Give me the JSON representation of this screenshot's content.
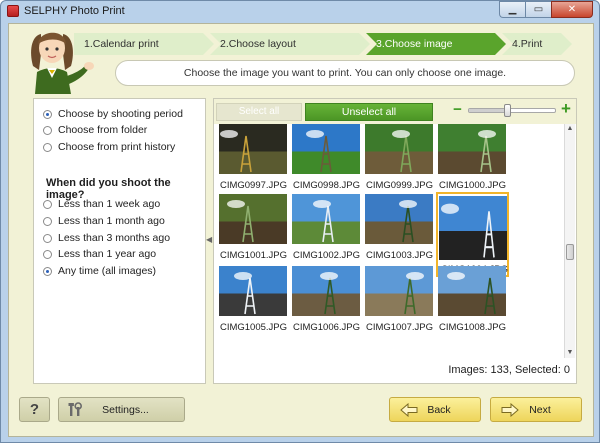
{
  "window": {
    "title": "SELPHY Photo Print",
    "minimize_icon": "minimize-icon",
    "maximize_icon": "maximize-icon",
    "close_icon": "close-icon"
  },
  "steps": [
    {
      "label": "1.Calendar print",
      "active": false
    },
    {
      "label": "2.Choose layout",
      "active": false
    },
    {
      "label": "3.Choose image",
      "active": true
    },
    {
      "label": "4.Print",
      "active": false
    }
  ],
  "instruction": "Choose the image you want to print. You can only choose one image.",
  "filter_mode": {
    "options": [
      {
        "label": "Choose by shooting period",
        "selected": true
      },
      {
        "label": "Choose from folder",
        "selected": false
      },
      {
        "label": "Choose from print history",
        "selected": false
      }
    ]
  },
  "period": {
    "heading": "When did you shoot the image?",
    "options": [
      {
        "label": "Less than 1 week ago",
        "selected": false
      },
      {
        "label": "Less than 1 month ago",
        "selected": false
      },
      {
        "label": "Less than 3 months ago",
        "selected": false
      },
      {
        "label": "Less than 1 year ago",
        "selected": false
      },
      {
        "label": "Any time (all images)",
        "selected": true
      }
    ]
  },
  "toolbar": {
    "select_all_label": "Select all",
    "unselect_all_label": "Unselect all",
    "zoom_minus": "−",
    "zoom_plus": "+",
    "zoom_level": 0.45
  },
  "images": [
    {
      "name": "CIMG0997.JPG",
      "selected": false
    },
    {
      "name": "CIMG0998.JPG",
      "selected": false
    },
    {
      "name": "CIMG0999.JPG",
      "selected": false
    },
    {
      "name": "CIMG1000.JPG",
      "selected": false
    },
    {
      "name": "CIMG1001.JPG",
      "selected": false
    },
    {
      "name": "CIMG1002.JPG",
      "selected": false
    },
    {
      "name": "CIMG1003.JPG",
      "selected": false
    },
    {
      "name": "CIMG1004.JPG",
      "selected": true
    },
    {
      "name": "CIMG1005.JPG",
      "selected": false
    },
    {
      "name": "CIMG1006.JPG",
      "selected": false
    },
    {
      "name": "CIMG1007.JPG",
      "selected": false
    },
    {
      "name": "CIMG1008.JPG",
      "selected": false
    }
  ],
  "status": "Images: 133, Selected: 0",
  "bottom": {
    "help_label": "?",
    "settings_label": "Settings...",
    "back_label": "Back",
    "next_label": "Next"
  },
  "colors": {
    "accent_green": "#5aa42c",
    "selection_border": "#f2b52b",
    "panel_bg": "#f2f2d6"
  }
}
